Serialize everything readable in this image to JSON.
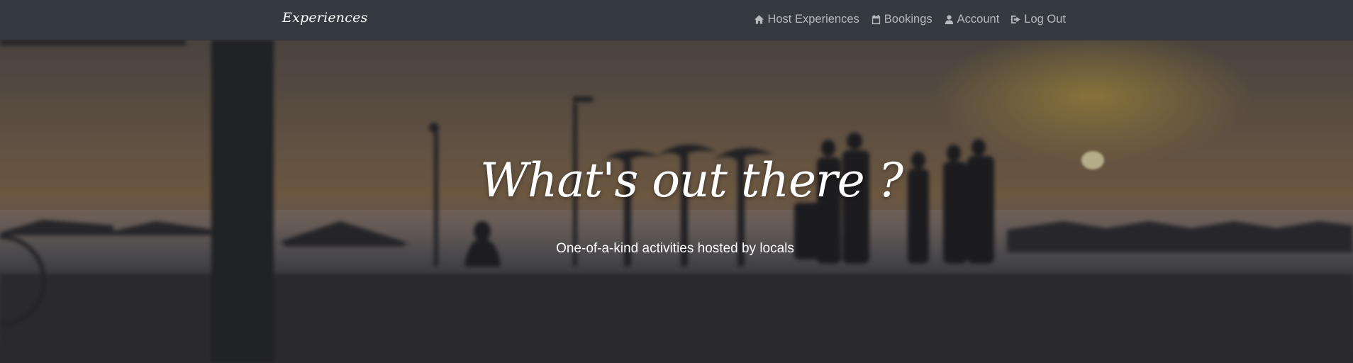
{
  "navbar": {
    "brand": "Experiences",
    "links": [
      {
        "label": "Host Experiences",
        "icon": "home-icon"
      },
      {
        "label": "Bookings",
        "icon": "calendar-icon"
      },
      {
        "label": "Account",
        "icon": "user-icon"
      },
      {
        "label": "Log Out",
        "icon": "sign-out-icon"
      }
    ],
    "background_color": "#353a41",
    "link_color": "#b7babd"
  },
  "hero": {
    "title": "What's out there ?",
    "subtitle": "One-of-a-kind activities hosted by locals",
    "background": "sunset beach promenade photo"
  }
}
